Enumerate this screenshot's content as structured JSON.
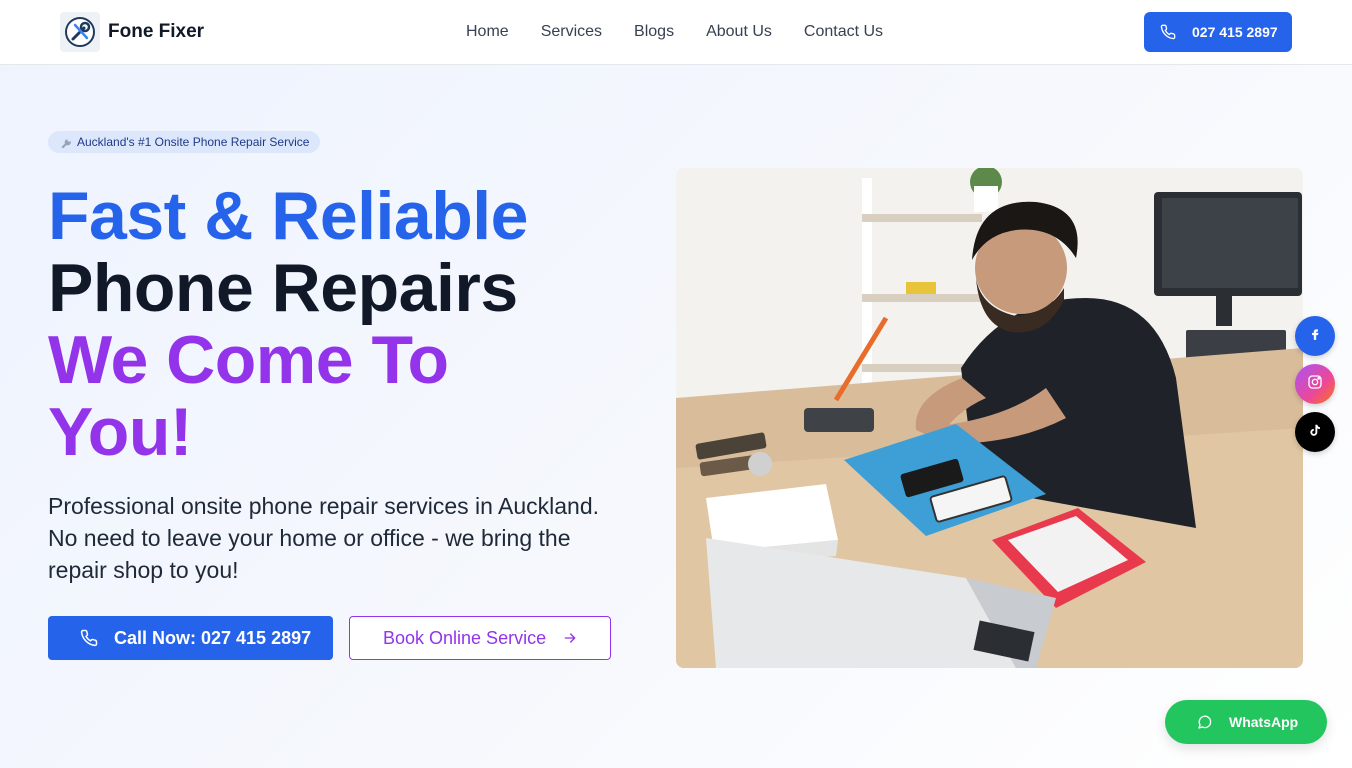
{
  "header": {
    "brand": "Fone Fixer",
    "nav": [
      "Home",
      "Services",
      "Blogs",
      "About Us",
      "Contact Us"
    ],
    "phone": "027 415 2897"
  },
  "hero": {
    "badge": "Auckland's #1 Onsite Phone Repair Service",
    "headline": {
      "line1": "Fast & Reliable",
      "line2": "Phone Repairs",
      "line3": "We Come To",
      "line4": "You!"
    },
    "lead": "Professional onsite phone repair services in Auckland. No need to leave your home or office - we bring the repair shop to you!",
    "call_button": "Call Now: 027 415 2897",
    "book_button": "Book Online Service"
  },
  "social": {
    "facebook_icon": "facebook-icon",
    "instagram_icon": "instagram-icon",
    "tiktok_icon": "tiktok-icon"
  },
  "whatsapp": {
    "label": "WhatsApp"
  },
  "colors": {
    "primary": "#2563eb",
    "accent": "#9333ea",
    "dark": "#111827",
    "whatsapp": "#22c55e"
  }
}
